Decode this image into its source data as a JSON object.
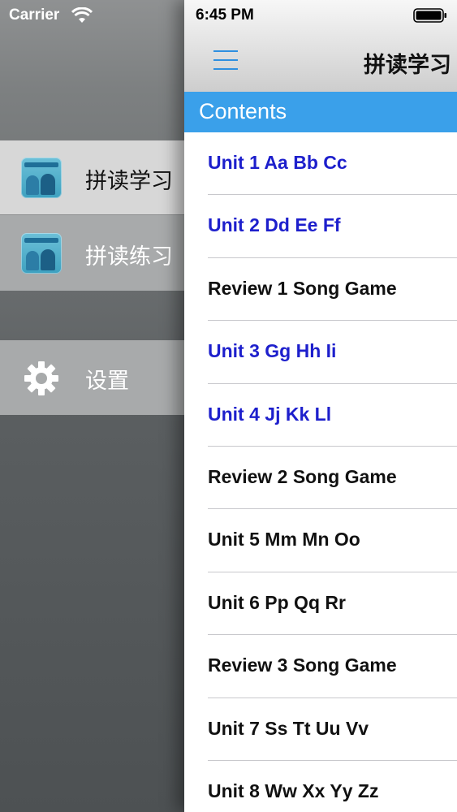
{
  "status_bar": {
    "carrier": "Carrier",
    "time": "6:45 PM"
  },
  "menu": {
    "items": [
      {
        "label": "拼读学习",
        "icon": "book-cover-icon",
        "selected": true
      },
      {
        "label": "拼读练习",
        "icon": "book-cover-icon",
        "selected": false
      },
      {
        "label": "设置",
        "icon": "gear-icon",
        "selected": false
      }
    ]
  },
  "nav": {
    "title": "拼读学习"
  },
  "contents": {
    "header": "Contents",
    "items": [
      {
        "label": "Unit 1 Aa Bb Cc",
        "highlighted": true
      },
      {
        "label": "Unit 2 Dd Ee Ff",
        "highlighted": true
      },
      {
        "label": "Review 1 Song Game",
        "highlighted": false
      },
      {
        "label": "Unit 3 Gg Hh Ii",
        "highlighted": true
      },
      {
        "label": "Unit 4 Jj Kk Ll",
        "highlighted": true
      },
      {
        "label": "Review 2 Song Game",
        "highlighted": false
      },
      {
        "label": "Unit 5 Mm Mn Oo",
        "highlighted": false
      },
      {
        "label": "Unit 6 Pp Qq Rr",
        "highlighted": false
      },
      {
        "label": "Review 3 Song Game",
        "highlighted": false
      },
      {
        "label": "Unit 7 Ss Tt Uu Vv",
        "highlighted": false
      },
      {
        "label": "Unit 8 Ww Xx Yy Zz",
        "highlighted": false
      }
    ]
  },
  "colors": {
    "accent": "#3aa0ea",
    "link": "#1d1fcc",
    "hamburger": "#2e8fe0"
  }
}
